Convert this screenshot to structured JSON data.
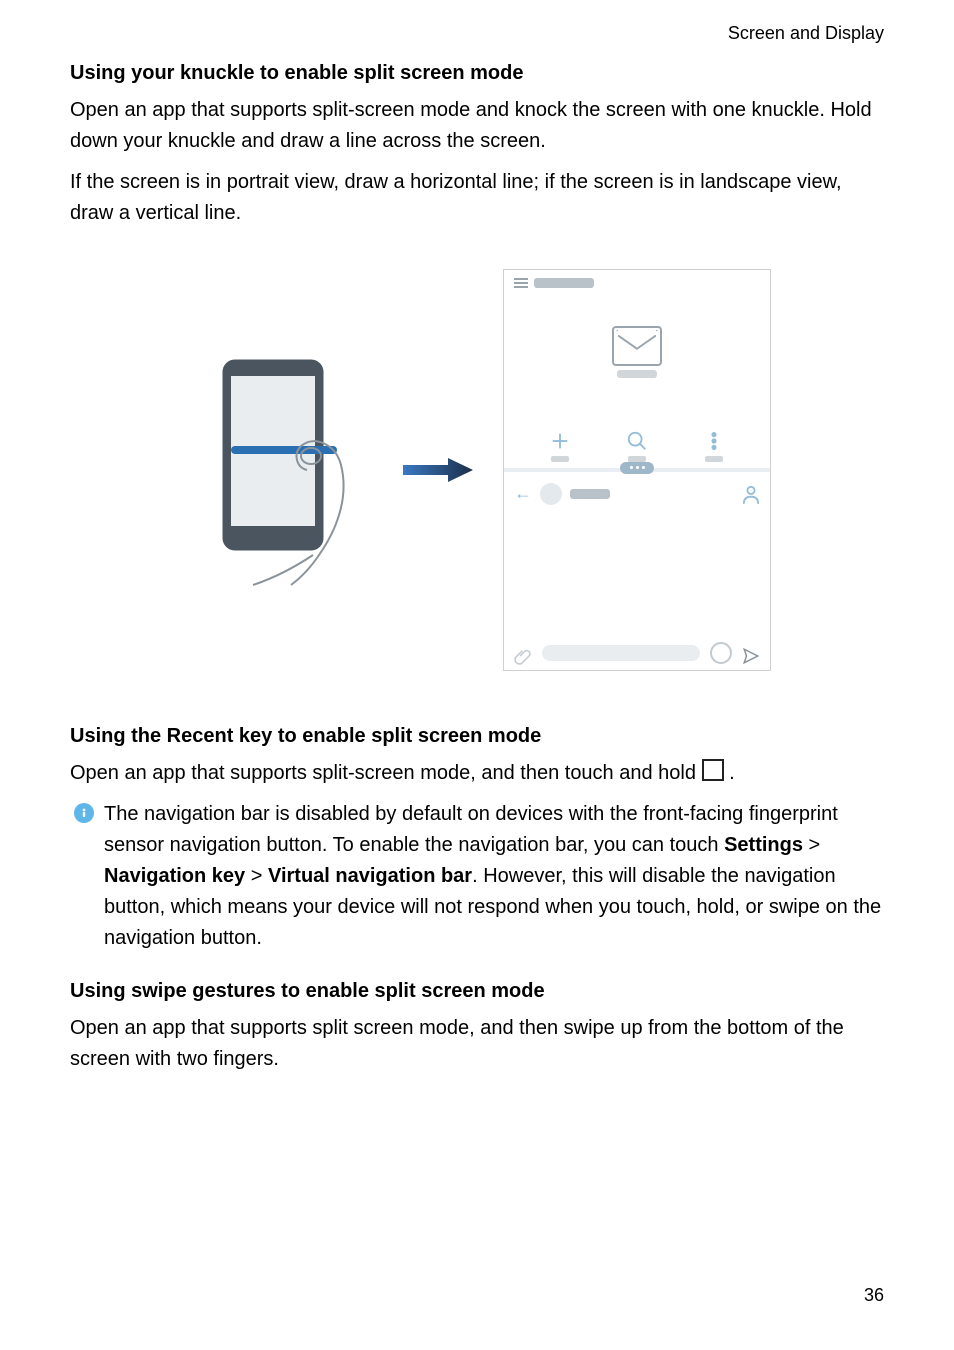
{
  "header": {
    "category": "Screen and Display"
  },
  "sections": {
    "knuckle": {
      "title": "Using your knuckle to enable split screen mode",
      "p1": "Open an app that supports split-screen mode and knock the screen with one knuckle. Hold down your knuckle and draw a line across the screen.",
      "p2": "If the screen is in portrait view, draw a horizontal line; if the screen is in landscape view, draw a vertical line."
    },
    "recent": {
      "title": "Using the Recent key to enable split screen mode",
      "p_before": "Open an app that supports split-screen mode, and then touch and hold ",
      "p_after": " ."
    },
    "note": {
      "text_1": "The navigation bar is disabled by default on devices with the front-facing fingerprint sensor navigation button. To enable the navigation bar, you can touch ",
      "settings": "Settings",
      "sep1": " > ",
      "navkey": "Navigation key",
      "sep2": " > ",
      "vnav": "Virtual navigation bar",
      "text_2": ". However, this will disable the navigation button, which means your device will not respond when you touch, hold, or swipe on the navigation button."
    },
    "swipe": {
      "title": "Using swipe gestures to enable split screen mode",
      "p": "Open an app that supports split screen mode, and then swipe up from the bottom of the screen with two fingers."
    }
  },
  "page_number": "36"
}
